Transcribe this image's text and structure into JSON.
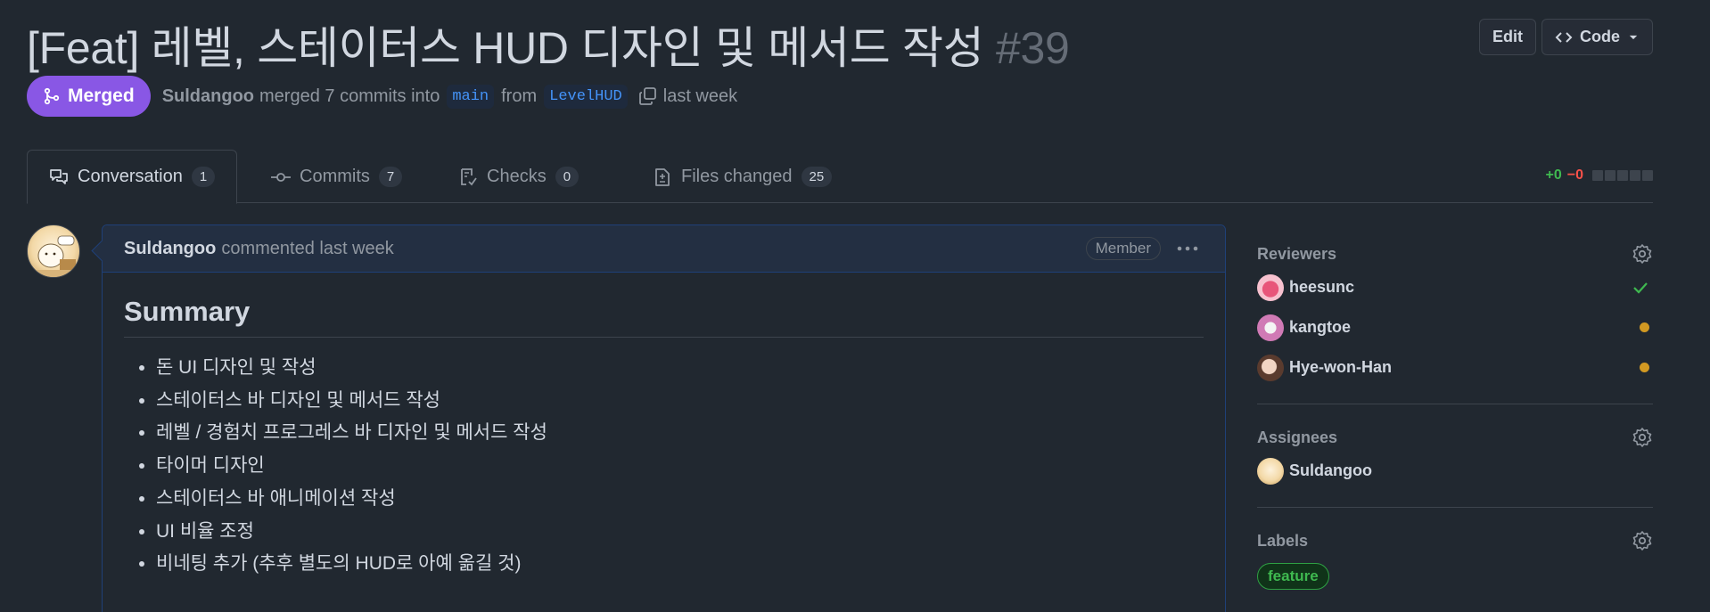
{
  "pr": {
    "title": "[Feat] 레벨, 스테이터스 HUD 디자인 및 메서드 작성",
    "number": "#39",
    "state": "Merged",
    "author": "Suldangoo",
    "merged_text": "merged 7 commits into",
    "base_branch": "main",
    "from_text": "from",
    "head_branch": "LevelHUD",
    "time": "last week"
  },
  "actions": {
    "edit": "Edit",
    "code": "Code"
  },
  "tabs": [
    {
      "label": "Conversation",
      "count": "1"
    },
    {
      "label": "Commits",
      "count": "7"
    },
    {
      "label": "Checks",
      "count": "0"
    },
    {
      "label": "Files changed",
      "count": "25"
    }
  ],
  "diffstat": {
    "additions": "+0",
    "deletions": "−0"
  },
  "comment": {
    "author": "Suldangoo",
    "meta": "commented last week",
    "role": "Member",
    "heading": "Summary",
    "items": [
      "돈 UI 디자인 및 작성",
      "스테이터스 바 디자인 및 메서드 작성",
      "레벨 / 경험치 프로그레스 바 디자인 및 메서드 작성",
      "타이머 디자인",
      "스테이터스 바 애니메이션 작성",
      "UI 비율 조정",
      "비네팅 추가 (추후 별도의 HUD로 아예 옮길 것)"
    ]
  },
  "sidebar": {
    "reviewers_title": "Reviewers",
    "reviewers": [
      {
        "name": "heesunc",
        "status": "approved"
      },
      {
        "name": "kangtoe",
        "status": "pending"
      },
      {
        "name": "Hye-won-Han",
        "status": "pending"
      }
    ],
    "assignees_title": "Assignees",
    "assignees": [
      {
        "name": "Suldangoo"
      }
    ],
    "labels_title": "Labels",
    "labels": [
      {
        "name": "feature",
        "color": "#3fb950"
      }
    ]
  },
  "colors": {
    "background": "#212830",
    "merged": "#8957e5",
    "accent": "#4493f8",
    "approved": "#3fb950",
    "pending": "#d29922"
  }
}
